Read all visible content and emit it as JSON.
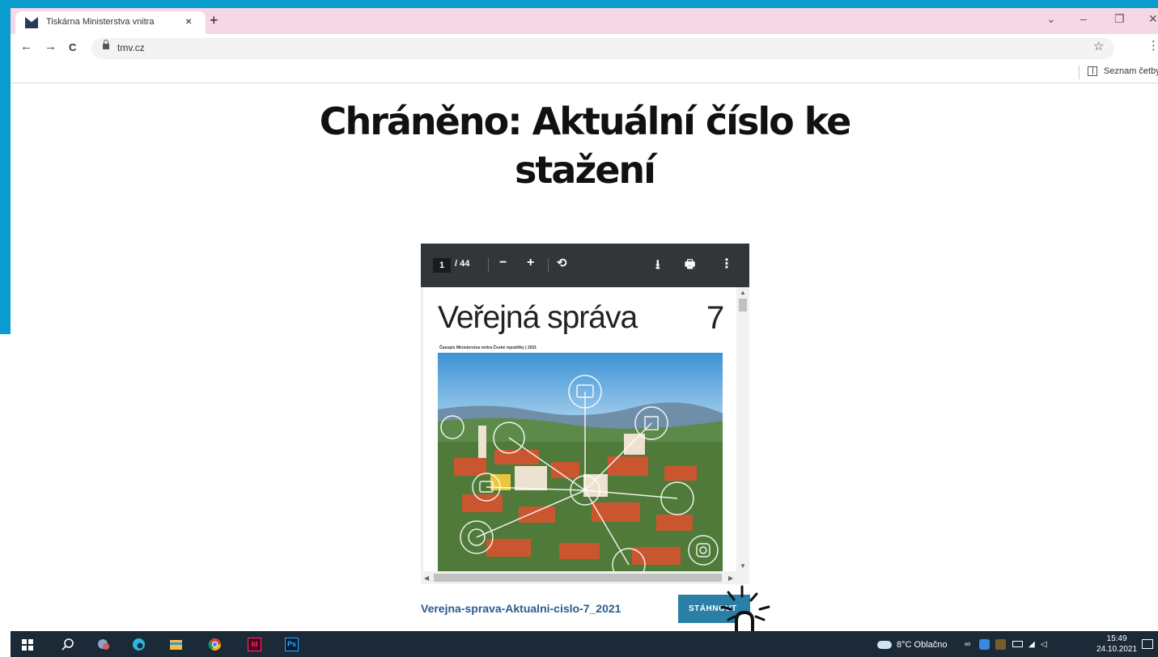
{
  "browser": {
    "tab_title": "Tiskárna Ministerstva vnitra",
    "tab_close": "×",
    "new_tab": "+",
    "window_controls": [
      "⌄",
      "–",
      "❐",
      "✕"
    ],
    "nav": {
      "back": "←",
      "forward": "→",
      "reload": "C"
    },
    "url": "tmv.cz",
    "star": "☆",
    "menu": "⋮",
    "reading_list": "Seznam četby"
  },
  "page": {
    "heading_line1": "Chráněno: Aktuální číslo ke",
    "heading_line2": "stažení"
  },
  "pdf_viewer": {
    "current_page": "1",
    "total_pages": "/ 44",
    "zoom_out": "−",
    "zoom_in": "+",
    "rotate": "⟲",
    "download": "⭳",
    "print": "🖶",
    "more": "⋮",
    "document": {
      "title": "Veřejná správa",
      "issue": "7",
      "subtitle": "Časopis Ministerstva vnitra České republiky | 2021"
    }
  },
  "download": {
    "file_name": "Verejna-sprava-Aktualni-cislo-7_2021",
    "button_label": "STÁHNOUT"
  },
  "taskbar": {
    "weather": "8°C Oblačno",
    "time": "15:49",
    "date": "24.10.2021",
    "app_labels": [
      "Id",
      "Ps"
    ]
  },
  "colors": {
    "frame_blue": "#0b9ccf",
    "tab_bar_pink": "#f6d7e6",
    "pdf_toolbar": "#323639",
    "link_blue": "#2a5b8c",
    "button_blue": "#2a7fa6",
    "taskbar": "#1c2937"
  }
}
